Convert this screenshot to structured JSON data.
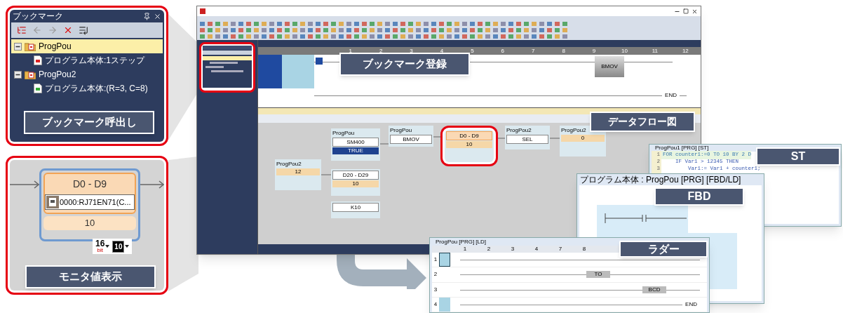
{
  "bookmark_panel": {
    "title": "ブックマーク",
    "tree": [
      {
        "label": "ProgPou",
        "selected": true,
        "expanded": true,
        "children": [
          {
            "label": "プログラム本体:1ステップ"
          }
        ]
      },
      {
        "label": "ProgPou2",
        "selected": false,
        "expanded": true,
        "children": [
          {
            "label": "プログラム本体:(R=3, C=8)"
          }
        ]
      }
    ],
    "callout": "ブックマーク呼出し"
  },
  "monitor_panel": {
    "node_title": "D0 - D9",
    "device": "0000:RJ71EN71(C...",
    "value": "10",
    "format_number": "16",
    "format_unit": "bit",
    "display_mode": "10",
    "callout": "モニタ値表示"
  },
  "main_window": {
    "ladder_columns": [
      "1",
      "2",
      "3",
      "4",
      "5",
      "6",
      "7",
      "8",
      "9",
      "10",
      "11",
      "12"
    ],
    "ladder_instruction": "BMOV",
    "ladder_end": "END",
    "bookmark_callout": "ブックマーク登録",
    "dataflow_callout": "データフロー図",
    "dataflow_nodes": [
      {
        "group": "ProgPou2",
        "value": "12",
        "highlighted": false
      },
      {
        "group": "ProgPou",
        "title": "SM400",
        "value": "TRUE",
        "highlighted": false
      },
      {
        "title": "D20 - D29",
        "value": "10",
        "highlighted": false
      },
      {
        "title": "K10",
        "highlighted": false
      },
      {
        "group": "ProgPou",
        "title": "BMOV",
        "highlighted": false
      },
      {
        "title": "D0 - D9",
        "value": "10",
        "highlighted": true
      },
      {
        "group": "ProgPou2",
        "title": "SEL",
        "highlighted": false
      },
      {
        "group": "ProgPou2",
        "value": "0",
        "highlighted": false
      }
    ]
  },
  "st_window": {
    "title": "ProgPou1 [PRG] [ST]",
    "code": [
      {
        "number": "1",
        "text": "FOR counter1:=0 TO 10 BY 2 D"
      },
      {
        "number": "2",
        "text": "    IF Var1 > 12345 THEN"
      },
      {
        "number": "3",
        "text": "        Var1:= Var1 + counter1;"
      }
    ],
    "callout": "ST"
  },
  "fbd_window": {
    "title": "プログラム本体 : ProgPou [PRG] [FBD/LD]",
    "callout": "FBD"
  },
  "ladder_window": {
    "title": "ProgPou [PRG] [LD]",
    "columns": [
      "1",
      "2",
      "3",
      "4",
      "7",
      "8"
    ],
    "rows": [
      "1",
      "2",
      "3",
      "4"
    ],
    "instructions": [
      "TO",
      "BCD"
    ],
    "end": "END",
    "callout": "ラダー"
  }
}
